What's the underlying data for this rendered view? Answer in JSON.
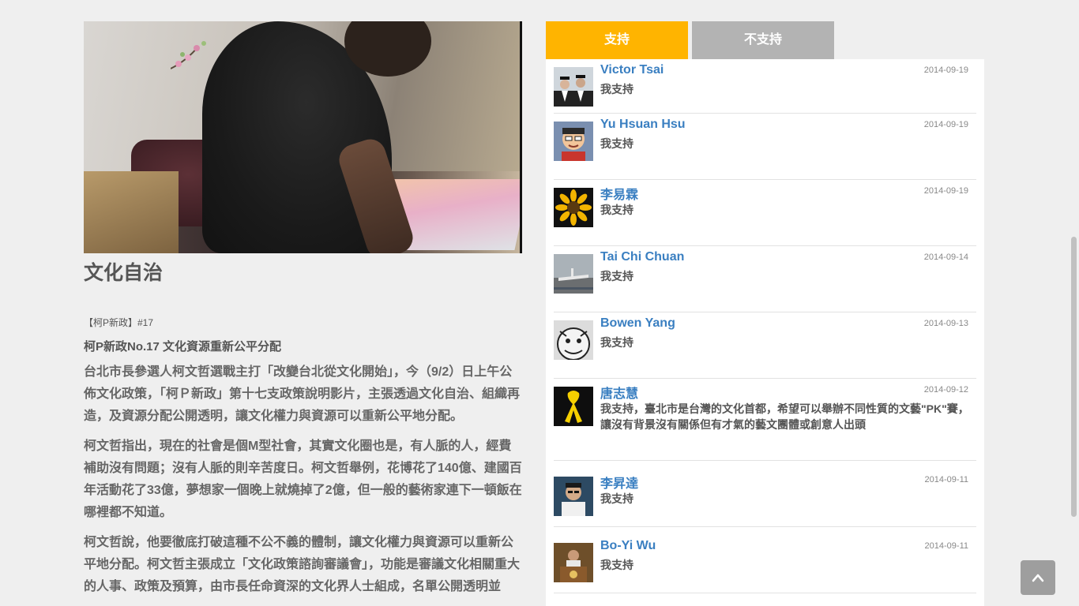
{
  "article": {
    "title": "文化自治",
    "tag": "【柯P新政】#17",
    "subtitle": "柯P新政No.17  文化資源重新公平分配",
    "paragraphs": [
      "台北市長參選人柯文哲選戰主打「改變台北從文化開始」，今（9/2）日上午公佈文化政策，「柯Ｐ新政」第十七支政策說明影片，主張透過文化自治、組織再造，及資源分配公開透明，讓文化權力與資源可以重新公平地分配。",
      "柯文哲指出，現在的社會是個M型社會，其實文化圈也是，有人脈的人，經費補助沒有問題；沒有人脈的則辛苦度日。柯文哲舉例，花博花了140億、建國百年活動花了33億，夢想家一個晚上就燒掉了2億，但一般的藝術家連下一頓飯在哪裡都不知道。",
      "柯文哲說，他要徹底打破這種不公不義的體制，讓文化權力與資源可以重新公平地分配。柯文哲主張成立「文化政策諮詢審議會」，功能是審議文化相關重大的人事、政策及預算，由市長任命資深的文化界人士組成，名單公開透明並"
    ]
  },
  "tabs": {
    "support": "支持",
    "oppose": "不支持"
  },
  "supporters": [
    {
      "name": "Victor Tsai",
      "date": "2014-09-19",
      "comment": "我支持",
      "avatar": "graduation-photo"
    },
    {
      "name": "Yu Hsuan Hsu",
      "date": "2014-09-19",
      "comment": "我支持",
      "avatar": "cartoon-face"
    },
    {
      "name": "李易霖",
      "date": "2014-09-19",
      "comment": "我支持",
      "avatar": "sunflower"
    },
    {
      "name": "Tai Chi Chuan",
      "date": "2014-09-14",
      "comment": "我支持",
      "avatar": "airplane-photo"
    },
    {
      "name": "Bowen Yang",
      "date": "2014-09-13",
      "comment": "我支持",
      "avatar": "bw-cartoon"
    },
    {
      "name": "唐志慧",
      "date": "2014-09-12",
      "comment": "我支持，臺北市是台灣的文化首都，希望可以舉辦不同性質的文藝\"PK\"賽，讓沒有背景沒有關係但有才氣的藝文團體或創意人出頭",
      "avatar": "yellow-ribbon"
    },
    {
      "name": "李昇達",
      "date": "2014-09-11",
      "comment": "我支持",
      "avatar": "portrait-photo"
    },
    {
      "name": "Bo-Yi Wu",
      "date": "2014-09-11",
      "comment": "我支持",
      "avatar": "speaker-photo"
    }
  ],
  "back_to_top": {
    "icon": "chevron-up-icon"
  }
}
